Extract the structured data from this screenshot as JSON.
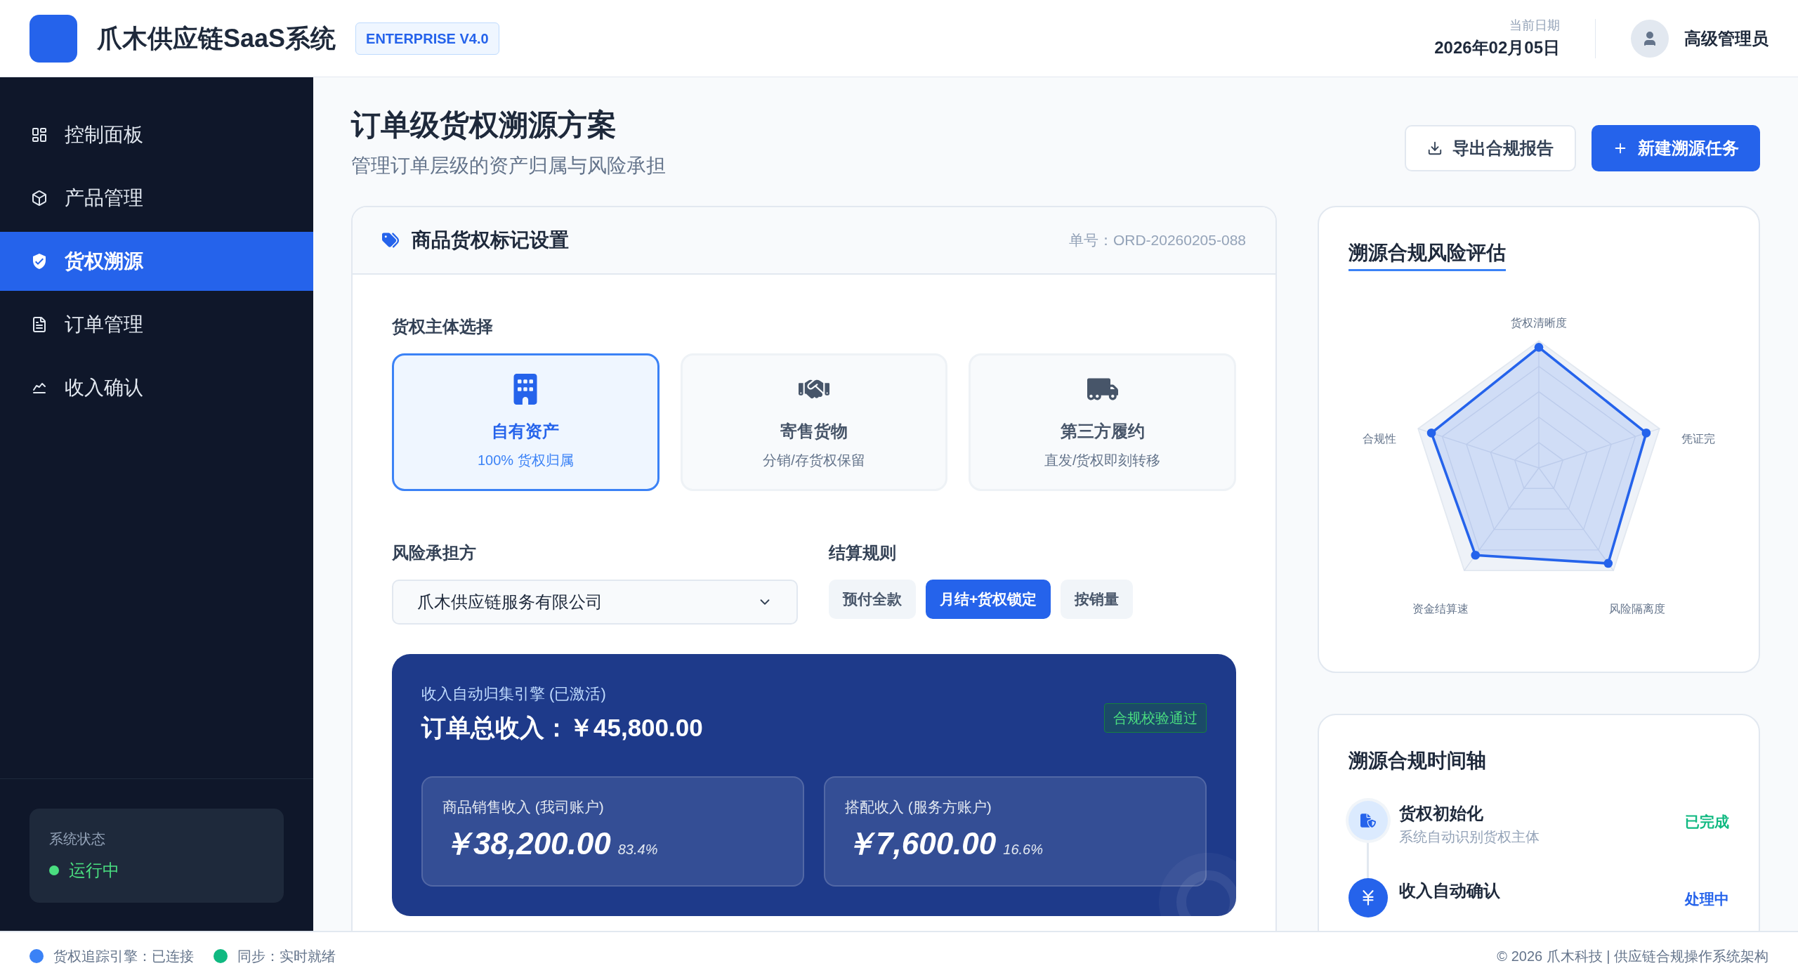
{
  "header": {
    "title": "爪木供应链SaaS系统",
    "badge": "ENTERPRISE V4.0",
    "date_label": "当前日期",
    "date": "2026年02月05日",
    "user": "高级管理员"
  },
  "sidebar": {
    "items": [
      {
        "label": "控制面板",
        "selected": false
      },
      {
        "label": "产品管理",
        "selected": false
      },
      {
        "label": "货权溯源",
        "selected": true
      },
      {
        "label": "订单管理",
        "selected": false
      },
      {
        "label": "收入确认",
        "selected": false
      }
    ],
    "status": {
      "label": "系统状态",
      "value": "运行中"
    }
  },
  "page": {
    "title": "订单级货权溯源方案",
    "subtitle": "管理订单层级的资产归属与风险承担",
    "actions": [
      {
        "label": "导出合规报告",
        "kind": "secondary"
      },
      {
        "label": "新建溯源任务",
        "kind": "primary"
      }
    ]
  },
  "ownership_card": {
    "title": "商品货权标记设置",
    "order_no": "单号：ORD-20260205-088",
    "section_label": "货权主体选择",
    "options": [
      {
        "title": "自有资产",
        "subtitle": "100% 货权归属",
        "selected": true
      },
      {
        "title": "寄售货物",
        "subtitle": "分销/存货权保留",
        "selected": false
      },
      {
        "title": "第三方履约",
        "subtitle": "直发/货权即刻转移",
        "selected": false
      }
    ],
    "risk_label": "风险承担方",
    "risk_value": "爪木供应链服务有限公司",
    "settlement_label": "结算规则",
    "settlement_options": [
      {
        "label": "预付全款",
        "selected": false
      },
      {
        "label": "月结+货权锁定",
        "selected": true
      },
      {
        "label": "按销量",
        "selected": false
      }
    ],
    "revenue": {
      "caption": "收入自动归集引擎 (已激活)",
      "total": "订单总收入：￥45,800.00",
      "badge": "合规校验通过",
      "splits": [
        {
          "label": "商品销售收入 (我司账户)",
          "amount": "￥38,200.00",
          "share": "83.4%"
        },
        {
          "label": "搭配收入 (服务方账户)",
          "amount": "￥7,600.00",
          "share": "16.6%"
        }
      ]
    }
  },
  "risk_card": {
    "title": "溯源合规风险评估",
    "axes": [
      "货权清晰度",
      "凭证完",
      "风险隔离度",
      "资金结算速",
      "合规性"
    ]
  },
  "timeline": {
    "title": "溯源合规时间轴",
    "events": [
      {
        "title": "货权初始化",
        "subtitle": "系统自动识别货权主体",
        "status": "已完成",
        "kind": "done"
      },
      {
        "title": "收入自动确认",
        "status": "处理中",
        "kind": "active"
      }
    ]
  },
  "status_bar": {
    "items": [
      {
        "label": "货权追踪引擎：已连接",
        "color": "#3b82f6"
      },
      {
        "label": "同步：实时就绪",
        "color": "#10b981"
      }
    ],
    "copyright": "© 2026 爪木科技 | 供应链合规操作系统架构"
  }
}
